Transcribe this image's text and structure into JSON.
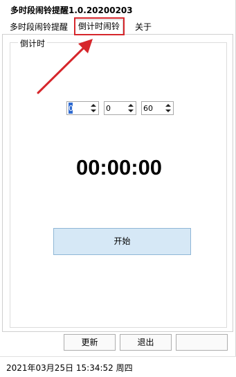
{
  "window": {
    "title": "多时段闹铃提醒1.0.20200203"
  },
  "tabs": [
    {
      "label": "多时段闹铃提醒"
    },
    {
      "label": "倒计时闹铃"
    },
    {
      "label": "关于"
    }
  ],
  "group": {
    "label": "倒计时"
  },
  "spinners": [
    {
      "value": "0"
    },
    {
      "value": "0"
    },
    {
      "value": "60"
    }
  ],
  "timer": {
    "display": "00:00:00"
  },
  "start_button": {
    "label": "开始"
  },
  "bottom_buttons": [
    {
      "label": "更新"
    },
    {
      "label": "退出"
    },
    {
      "label": ""
    }
  ],
  "status_bar": {
    "datetime": "2021年03月25日 15:34:52 周四"
  },
  "colors": {
    "highlight": "#d6262b",
    "arrow": "#d6262b",
    "start_button_bg": "#d6e8f6"
  },
  "icons": {
    "spinner": "up-down-arrows-icon",
    "annotation": "red-arrow"
  }
}
